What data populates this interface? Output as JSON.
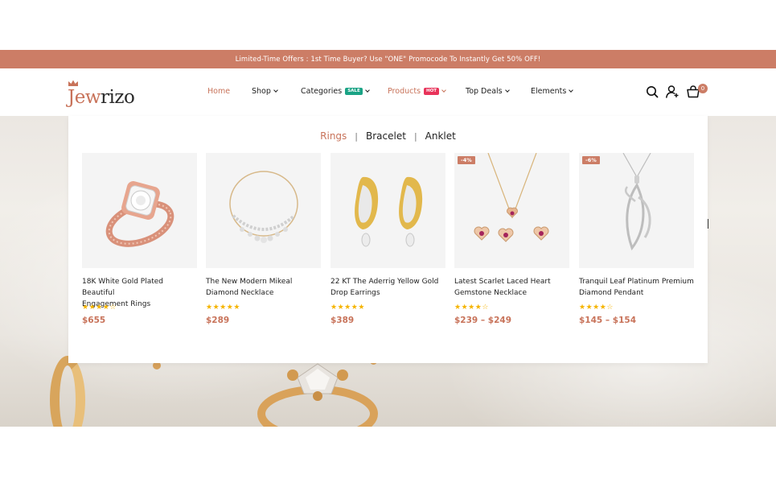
{
  "promo": {
    "text": "Limited-Time Offers : 1st Time Buyer? Use \"ONE\" Promocode To Instantly Get 50% OFF!"
  },
  "logo": {
    "part1": "Jew",
    "part2": "rizo"
  },
  "nav": {
    "home": "Home",
    "shop": "Shop",
    "categories": "Categories",
    "categories_badge": "SALE",
    "products": "Products",
    "products_badge": "HOT",
    "top_deals": "Top Deals",
    "elements": "Elements"
  },
  "header_icons": [
    "search-icon",
    "account-icon",
    "cart-icon"
  ],
  "cart": {
    "count": "0"
  },
  "mega": {
    "tabs": [
      {
        "label": "Rings",
        "active": true
      },
      {
        "label": "Bracelet",
        "active": false
      },
      {
        "label": "Anklet",
        "active": false
      }
    ],
    "products": [
      {
        "name_line1": "18K White Gold Plated Beautiful",
        "name_line2": "Engagement Rings",
        "rating": 4,
        "price": "$655",
        "discount": ""
      },
      {
        "name_line1": "The New Modern Mikeal",
        "name_line2": "Diamond Necklace",
        "rating": 5,
        "price": "$289",
        "discount": ""
      },
      {
        "name_line1": "22 KT The Aderrig Yellow Gold",
        "name_line2": "Drop Earrings",
        "rating": 5,
        "price": "$389",
        "discount": ""
      },
      {
        "name_line1": "Latest Scarlet Laced Heart",
        "name_line2": "Gemstone Necklace",
        "rating": 4,
        "price": "$239 – $249",
        "discount": "-4%"
      },
      {
        "name_line1": "Tranquil Leaf Platinum Premium",
        "name_line2": "Diamond Pendant",
        "rating": 4,
        "price": "$145 – $154",
        "discount": "-6%"
      }
    ]
  },
  "colors": {
    "accent": "#cc7d66",
    "sale": "#1aa385",
    "hot": "#e8335a",
    "star": "#f5b400"
  }
}
